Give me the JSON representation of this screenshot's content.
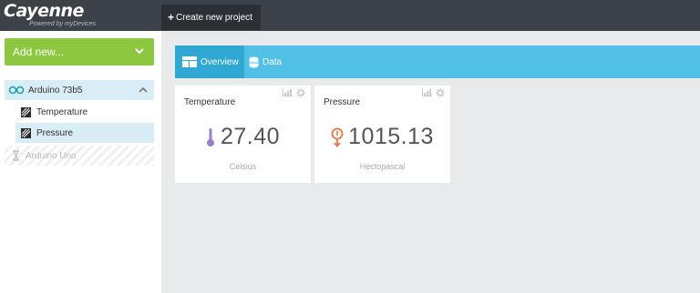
{
  "brand": {
    "name": "Cayenne",
    "tagline": "Powered by myDevices"
  },
  "topbar": {
    "create_label": "Create new project"
  },
  "sidebar": {
    "add_new_label": "Add new...",
    "device": {
      "label": "Arduino 73b5"
    },
    "widgets": [
      {
        "label": "Temperature"
      },
      {
        "label": "Pressure"
      }
    ],
    "offline_device": {
      "label": "Arduino Uno"
    }
  },
  "tabs": [
    {
      "label": "Overview"
    },
    {
      "label": "Data"
    }
  ],
  "cards": [
    {
      "title": "Temperature",
      "value": "27.40",
      "unit": "Celsius",
      "icon": "thermometer-icon",
      "icon_color": "#9b7fd1"
    },
    {
      "title": "Pressure",
      "value": "1015.13",
      "unit": "Hectopascal",
      "icon": "barometer-icon",
      "icon_color": "#f0743e"
    }
  ],
  "colors": {
    "topbar": "#3d4148",
    "accent_green": "#8dc63f",
    "tab_bar": "#51c0e6",
    "tab_active": "#2fa8d4",
    "selected_row": "#d8edf5"
  }
}
